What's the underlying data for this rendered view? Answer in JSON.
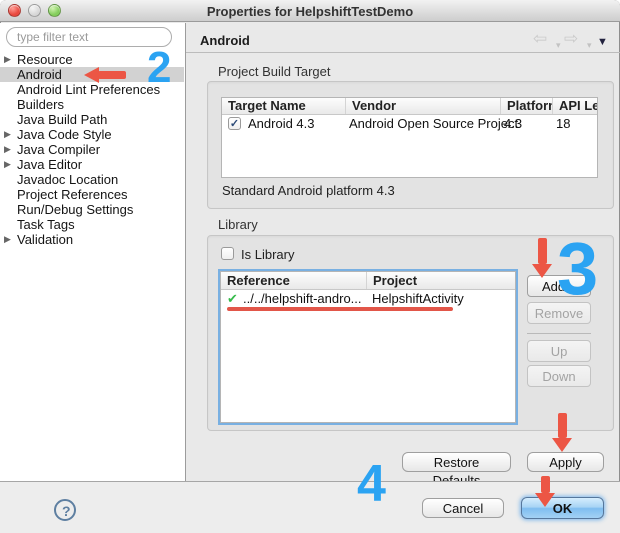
{
  "window": {
    "title": "Properties for HelpshiftTestDemo"
  },
  "icons": {
    "chevron": "▶",
    "back": "⇦",
    "forward": "⇨",
    "caret": "▾",
    "menu": "▼",
    "check": "✓",
    "green_check": "✔",
    "help": "?"
  },
  "sidebar": {
    "filter_placeholder": "type filter text",
    "items": [
      {
        "label": "Resource",
        "expandable": true,
        "selected": false
      },
      {
        "label": "Android",
        "expandable": false,
        "selected": true
      },
      {
        "label": "Android Lint Preferences",
        "expandable": false,
        "selected": false
      },
      {
        "label": "Builders",
        "expandable": false,
        "selected": false
      },
      {
        "label": "Java Build Path",
        "expandable": false,
        "selected": false
      },
      {
        "label": "Java Code Style",
        "expandable": true,
        "selected": false
      },
      {
        "label": "Java Compiler",
        "expandable": true,
        "selected": false
      },
      {
        "label": "Java Editor",
        "expandable": true,
        "selected": false
      },
      {
        "label": "Javadoc Location",
        "expandable": false,
        "selected": false
      },
      {
        "label": "Project References",
        "expandable": false,
        "selected": false
      },
      {
        "label": "Run/Debug Settings",
        "expandable": false,
        "selected": false
      },
      {
        "label": "Task Tags",
        "expandable": false,
        "selected": false
      },
      {
        "label": "Validation",
        "expandable": true,
        "selected": false
      }
    ]
  },
  "header": {
    "title": "Android"
  },
  "build_target": {
    "group_label": "Project Build Target",
    "columns": [
      "Target Name",
      "Vendor",
      "Platform",
      "API Level"
    ],
    "row": {
      "checked": true,
      "target_name": "Android 4.3",
      "vendor": "Android Open Source Project",
      "platform": "4.3",
      "api_level": "18"
    },
    "caption": "Standard Android platform 4.3"
  },
  "library": {
    "group_label": "Library",
    "is_library_label": "Is Library",
    "columns": [
      "Reference",
      "Project"
    ],
    "row": {
      "reference": "../../helpshift-andro...",
      "project": "HelpshiftActivity"
    },
    "buttons": {
      "add": "Add...",
      "remove": "Remove",
      "up": "Up",
      "down": "Down"
    }
  },
  "footer": {
    "restore_defaults": "Restore Defaults",
    "apply": "Apply",
    "cancel": "Cancel",
    "ok": "OK"
  },
  "annotations": {
    "step_sidebar": "2",
    "step_add": "3",
    "step_apply_ok": "4",
    "arrow_color": "#ec5645",
    "number_color": "#2ba3f2"
  }
}
